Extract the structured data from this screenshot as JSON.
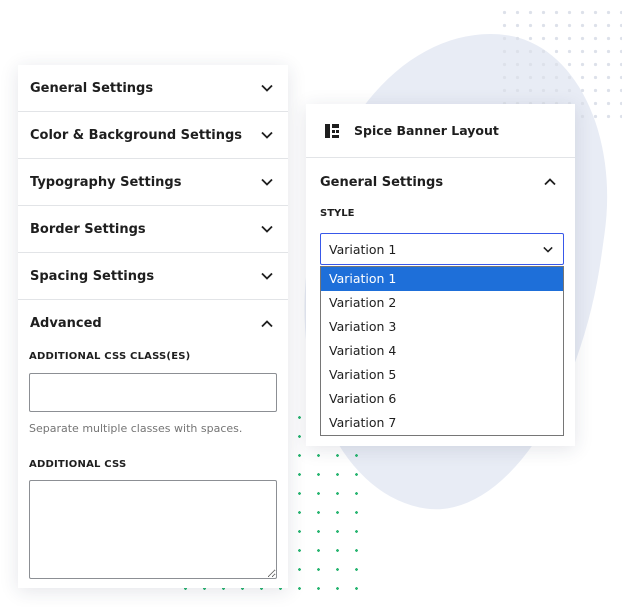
{
  "left_panel": {
    "sections": [
      {
        "label": "General Settings",
        "expanded": false
      },
      {
        "label": "Color & Background Settings",
        "expanded": false
      },
      {
        "label": "Typography Settings",
        "expanded": false
      },
      {
        "label": "Border Settings",
        "expanded": false
      },
      {
        "label": "Spacing Settings",
        "expanded": false
      },
      {
        "label": "Advanced",
        "expanded": true
      }
    ],
    "advanced": {
      "css_class_label": "ADDITIONAL CSS CLASS(ES)",
      "css_class_value": "",
      "css_class_help": "Separate multiple classes with spaces.",
      "css_label": "ADDITIONAL CSS",
      "css_value": ""
    }
  },
  "right_panel": {
    "block_title": "Spice Banner Layout",
    "block_icon": "layout-grid-icon",
    "section_label": "General Settings",
    "style_label": "STYLE",
    "select_value": "Variation 1",
    "options": [
      "Variation 1",
      "Variation 2",
      "Variation 3",
      "Variation 4",
      "Variation 5",
      "Variation 6",
      "Variation 7"
    ],
    "selected_index": 0
  },
  "colors": {
    "accent_border": "#3858e9",
    "option_selected": "#1e6fd9",
    "dots_green": "#2bb673",
    "blob": "#e8ecf5"
  }
}
